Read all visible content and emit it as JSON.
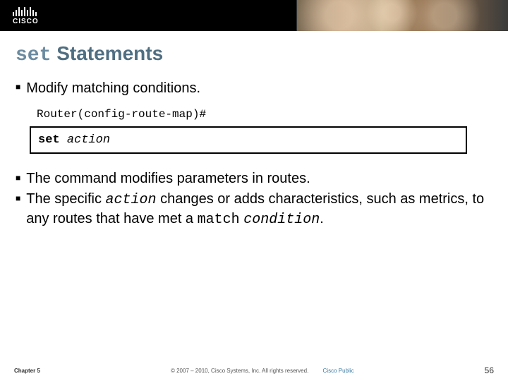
{
  "header": {
    "brand": "CISCO"
  },
  "title": {
    "keyword": "set",
    "rest": "Statements"
  },
  "bullets": {
    "b1": "Modify matching conditions."
  },
  "prompt": "Router(config-route-map)#",
  "command": {
    "keyword": "set",
    "arg": "action"
  },
  "desc": {
    "b2": "The command modifies parameters in routes.",
    "b3_a": "The specific ",
    "b3_action": "action",
    "b3_b": " changes or adds characteristics, such as metrics, to any routes that have met a ",
    "b3_match": "match",
    "b3_condition": "condition",
    "b3_end": "."
  },
  "footer": {
    "chapter": "Chapter 5",
    "copyright": "© 2007 – 2010, Cisco Systems, Inc. All rights reserved.",
    "classification": "Cisco Public",
    "page": "56"
  }
}
